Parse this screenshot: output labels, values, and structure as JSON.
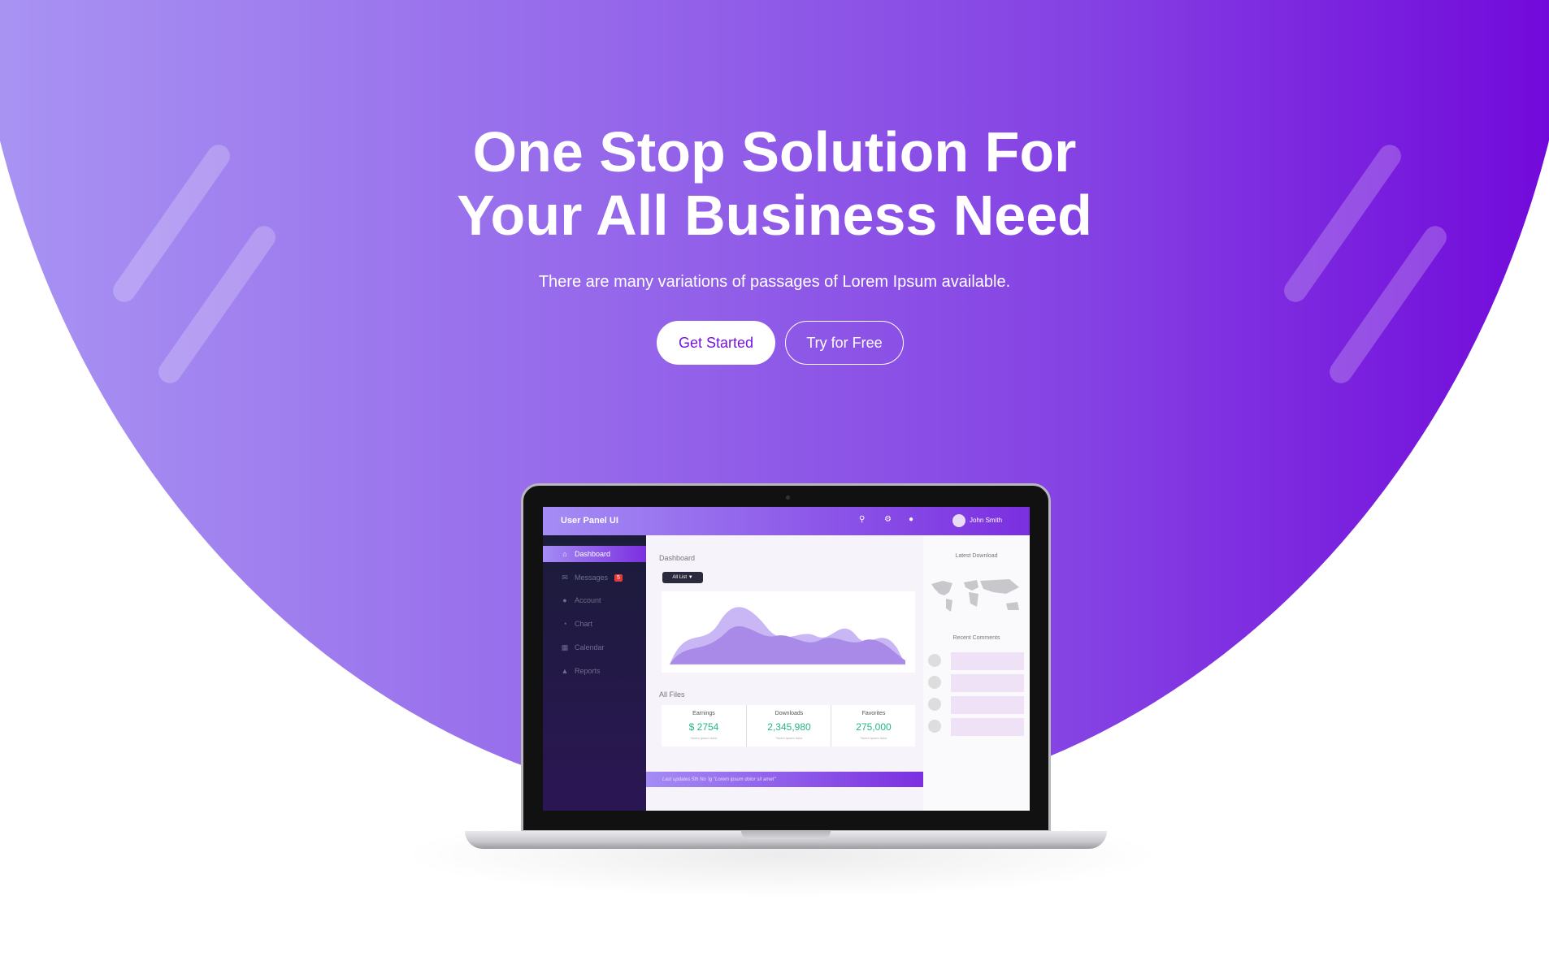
{
  "hero": {
    "title_line1": "One Stop Solution For",
    "title_line2": "Your All Business Need",
    "subtitle": "There are many variations of passages of Lorem Ipsum available.",
    "primary_button": "Get Started",
    "secondary_button": "Try for Free"
  },
  "dashboard": {
    "app_title": "User Panel UI",
    "user_name": "John Smith",
    "sidebar": [
      {
        "label": "Dashboard",
        "icon": "home-icon",
        "active": true
      },
      {
        "label": "Messages",
        "icon": "mail-icon",
        "badge": "5"
      },
      {
        "label": "Account",
        "icon": "user-icon"
      },
      {
        "label": "Chart",
        "icon": "pie-chart-icon"
      },
      {
        "label": "Calendar",
        "icon": "calendar-icon"
      },
      {
        "label": "Reports",
        "icon": "warning-icon"
      }
    ],
    "main_title": "Dashboard",
    "filter_label": "All List ▼",
    "files_title": "All Files",
    "stats": [
      {
        "label": "Earnings",
        "value": "$ 2754",
        "note": "*lorem ipsum dolor"
      },
      {
        "label": "Downloads",
        "value": "2,345,980",
        "note": "*lorem ipsum dolor"
      },
      {
        "label": "Favorites",
        "value": "275,000",
        "note": "*lorem ipsum dolor"
      }
    ],
    "footer_note": "Last updates 5th No 'ig \"Lorem ipsum dolor sit amet\"",
    "right_panel": {
      "latest_download": "Latest Download",
      "recent_comments": "Recent Comments"
    }
  },
  "colors": {
    "gradient_start": "#a995f3",
    "gradient_end": "#7106da",
    "primary_text": "#7414dc",
    "stat_value": "#23b58a"
  }
}
